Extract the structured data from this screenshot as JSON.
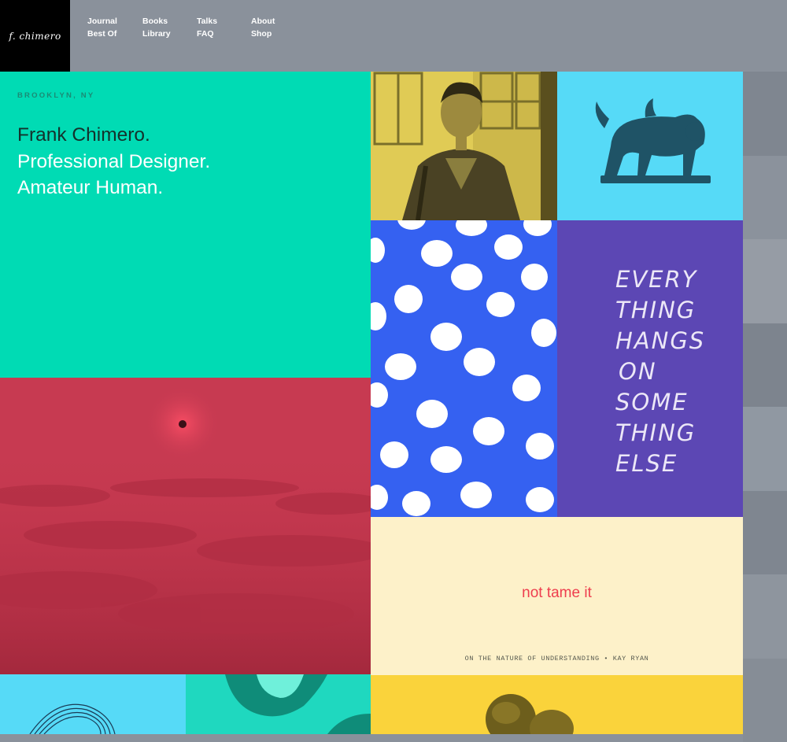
{
  "brand": {
    "logo_text": "f. chimero"
  },
  "nav": {
    "columns": [
      [
        "Journal",
        "Best Of"
      ],
      [
        "Books",
        "Library"
      ],
      [
        "Talks",
        "FAQ"
      ],
      [
        "About",
        "Shop"
      ]
    ]
  },
  "intro": {
    "location": "BROOKLYN, NY",
    "line1": "Frank Chimero.",
    "line2": "Professional Designer.",
    "line3": "Amateur Human."
  },
  "lettering": {
    "lines": [
      "EVERY",
      "THING",
      "HANGS",
      "ON",
      "SOME",
      "THING",
      "ELSE"
    ]
  },
  "quote": {
    "text": "not tame it",
    "attribution": "ON THE NATURE OF UNDERSTANDING • KAY RYAN"
  },
  "colors": {
    "page_bg": "#8a919b",
    "intro_bg": "#00dbb4",
    "clouds_bg": "#c73a51",
    "portrait_bg": "#e0cb55",
    "creature_bg": "#56daf7",
    "dots_bg": "#3561f1",
    "lettering_bg": "#5c47b4",
    "quote_bg": "#fdf1c9",
    "quote_text": "#ee3e4e",
    "bottom_yellow": "#fad33b"
  },
  "icons": [
    "portrait-photo",
    "chimera-statue",
    "dot-pattern",
    "cloud-sea-photo",
    "hand-photo",
    "scribble-drawing"
  ]
}
